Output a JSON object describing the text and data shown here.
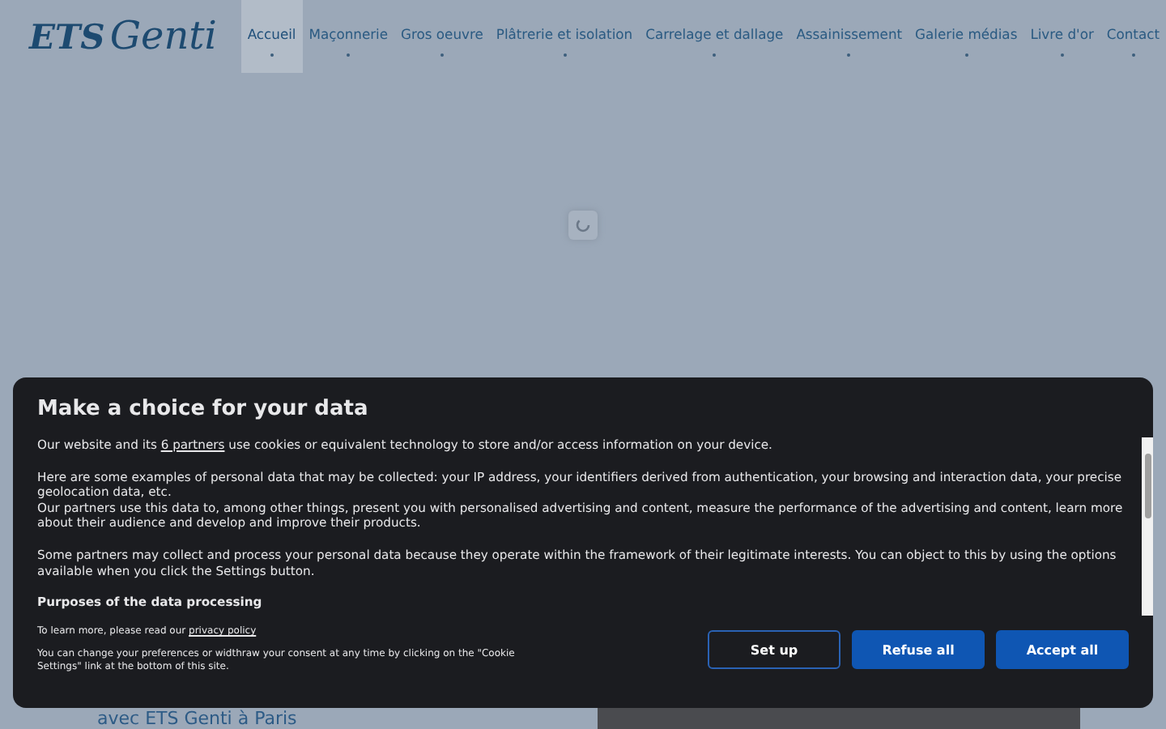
{
  "header": {
    "logo": {
      "part_1": "ETS",
      "part_2": "Genti"
    },
    "nav": [
      {
        "label": "Accueil",
        "selected": true
      },
      {
        "label": "Maçonnerie",
        "selected": false
      },
      {
        "label": "Gros oeuvre",
        "selected": false
      },
      {
        "label": "Plâtrerie et isolation",
        "selected": false
      },
      {
        "label": "Carrelage et dallage",
        "selected": false
      },
      {
        "label": "Assainissement",
        "selected": false
      },
      {
        "label": "Galerie médias",
        "selected": false
      },
      {
        "label": "Livre d'or",
        "selected": false
      },
      {
        "label": "Contact",
        "selected": false
      }
    ]
  },
  "hero": {
    "subtitle": "avec ETS Genti à Paris"
  },
  "consent": {
    "title": "Make a choice for your data",
    "paragraphs": [
      {
        "before": "Our website and its ",
        "link": "6 partners",
        "after": " use cookies or equivalent technology to store and/or access information on your device."
      },
      {
        "text": "Here are some examples of personal data that may be collected: your IP address, your identifiers derived from authentication, your browsing and interaction data, your precise geolocation data, etc.\nOur partners use this data to, among other things, present you with personalised advertising and content, measure the performance of the advertising and content, learn more about their audience and develop and improve their products."
      },
      {
        "text": "Some partners may collect and process your personal data because they operate within the framework of their legitimate interests. You can object to this by using the options available when you click the Settings button."
      }
    ],
    "section_heading": "Purposes of the data processing",
    "privacy": {
      "before": "To learn more, please read our ",
      "link": "privacy policy"
    },
    "note": "You can change your preferences or widthraw your consent at any time by clicking on the \"Cookie Settings\" link at the bottom of this site.",
    "buttons": [
      {
        "label": "Set up",
        "kind": "outline"
      },
      {
        "label": "Refuse all",
        "kind": "filled"
      },
      {
        "label": "Accept all",
        "kind": "filled"
      }
    ]
  }
}
